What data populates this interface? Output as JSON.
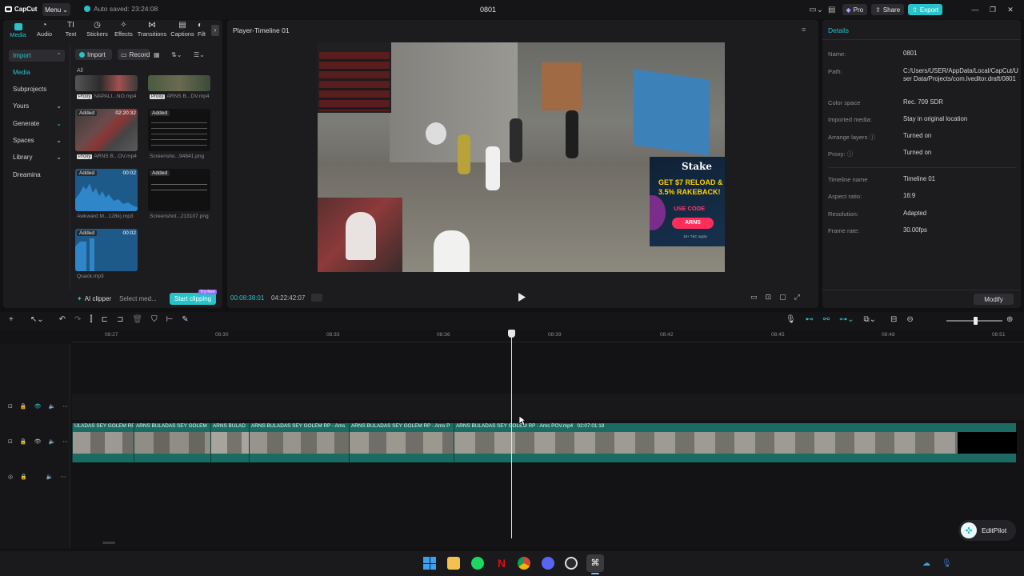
{
  "titlebar": {
    "logo": "CapCut",
    "menu_label": "Menu",
    "autosave": "Auto saved: 23:24:08",
    "window_title": "0801",
    "pro_label": "Pro",
    "share_label": "Share",
    "export_label": "Export"
  },
  "media_tabs": [
    {
      "label": "Media"
    },
    {
      "label": "Audio"
    },
    {
      "label": "Text"
    },
    {
      "label": "Stickers"
    },
    {
      "label": "Effects"
    },
    {
      "label": "Transitions"
    },
    {
      "label": "Captions"
    },
    {
      "label": "Filt"
    }
  ],
  "sidebar": {
    "import": "Import",
    "media": "Media",
    "subprojects": "Subprojects",
    "yours": "Yours",
    "generate": "Generate",
    "spaces": "Spaces",
    "library": "Library",
    "dreamina": "Dreamina"
  },
  "media_toolbar": {
    "import": "Import",
    "record": "Record",
    "filter_all": "All"
  },
  "media_items": [
    {
      "name": "NAPALI...NO.mp4",
      "proxy": "Proxy"
    },
    {
      "name": "ARNS B...DV.mp4",
      "proxy": "Proxy"
    },
    {
      "name": "ARNS B...OV.mp4",
      "proxy": "Proxy",
      "badge": "Added",
      "duration": "02:20:32"
    },
    {
      "name": "Screensho...94841.png",
      "badge": "Added"
    },
    {
      "name": "Awkward M...128k).mp3",
      "badge": "Added",
      "duration": "00:02"
    },
    {
      "name": "Screenshot...213107.png",
      "badge": "Added"
    },
    {
      "name": "Quack.mp3",
      "badge": "Added",
      "duration": "00:02"
    }
  ],
  "clipper": {
    "ai_label": "AI clipper",
    "select_label": "Select med...",
    "start_label": "Start clipping",
    "try_label": "Try free"
  },
  "player": {
    "title": "Player-Timeline 01",
    "current_time": "00:08:38:01",
    "total_time": "04:22:42:07",
    "ad": {
      "brand": "Stake",
      "line1": "GET $7 RELOAD &",
      "line2": "3.5% RAKEBACK!",
      "code_label": "USE CODE",
      "code": "ARNS",
      "fine": "18+ T&C apply"
    }
  },
  "details": {
    "title": "Details",
    "modify_label": "Modify",
    "rows": [
      {
        "name": "Name:",
        "value": "0801"
      },
      {
        "name": "Path:",
        "value": "C:/Users/USER/AppData/Local/CapCut/User Data/Projects/com.lveditor.draft/0801"
      },
      {
        "name": "Color space",
        "value": "Rec. 709 SDR"
      },
      {
        "name": "Imported media:",
        "value": "Stay in original location"
      },
      {
        "name": "Arrange layers",
        "value": "Turned on"
      },
      {
        "name": "Proxy:",
        "value": "Turned on"
      },
      {
        "name": "Timeline name",
        "value": "Timeline 01"
      },
      {
        "name": "Aspect ratio:",
        "value": "16:9"
      },
      {
        "name": "Resolution:",
        "value": "Adapted"
      },
      {
        "name": "Frame rate:",
        "value": "30.00fps"
      }
    ]
  },
  "timeline": {
    "ticks": [
      "08:27",
      "08:30",
      "08:33",
      "08:36",
      "08:39",
      "08:42",
      "08:45",
      "08:48",
      "08:51"
    ],
    "clips": [
      {
        "name": "ULADAS SEY GOLEM RP -"
      },
      {
        "name": "ARNS BULADAS SEY GOLEM"
      },
      {
        "name": "ARNS BULAD"
      },
      {
        "name": "ARNS BULADAS SEY GOLEM RP - Ams"
      },
      {
        "name": "ARNS BULADAS SEY GOLEM RP - Ams P"
      },
      {
        "name": "ARNS BULADAS SEY GOLEM RP - Ams POV.mp4",
        "duration": "02:07:01:18"
      }
    ]
  },
  "editpilot": {
    "label": "EditPilot"
  },
  "colors": {
    "accent": "#27c3c9",
    "clip": "#1b6b63",
    "panel": "#1c1c1f"
  }
}
